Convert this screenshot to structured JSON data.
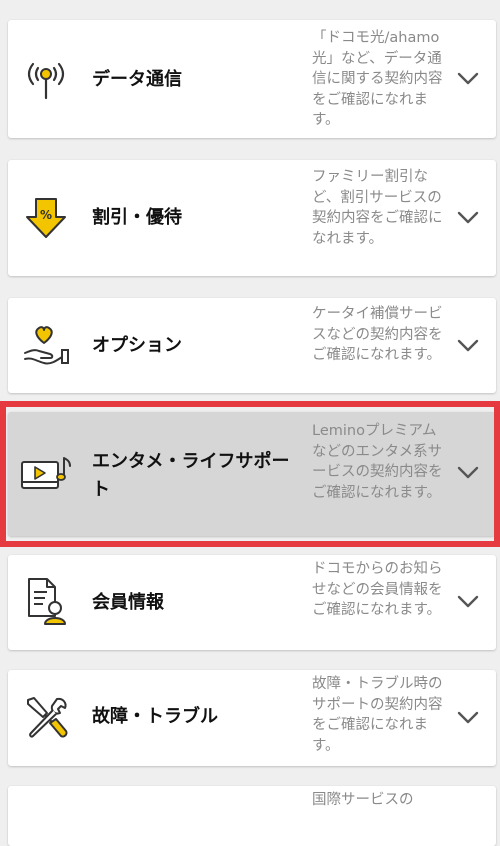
{
  "items": [
    {
      "title": "データ通信",
      "description": "「ドコモ光/ahamo光」など、データ通信に関する契約内容をご確認になれます。",
      "icon": "antenna-icon"
    },
    {
      "title": "割引・優待",
      "description": "ファミリー割引など、割引サービスの契約内容をご確認になれます。",
      "icon": "discount-arrow-icon"
    },
    {
      "title": "オプション",
      "description": "ケータイ補償サービスなどの契約内容をご確認になれます。",
      "icon": "hand-heart-icon"
    },
    {
      "title": "エンタメ・ライフサポート",
      "description": "Leminoプレミアムなどのエンタメ系サービスの契約内容をご確認になれます。",
      "icon": "video-music-icon"
    },
    {
      "title": "会員情報",
      "description": "ドコモからのお知らせなどの会員情報をご確認になれます。",
      "icon": "document-person-icon"
    },
    {
      "title": "故障・トラブル",
      "description": "故障・トラブル時のサポートの契約内容をご確認になれます。",
      "icon": "tools-icon"
    },
    {
      "title": "",
      "description": "国際サービスの",
      "icon": ""
    }
  ],
  "colors": {
    "accent": "#f2c500",
    "highlight_border": "#e53a3f"
  }
}
